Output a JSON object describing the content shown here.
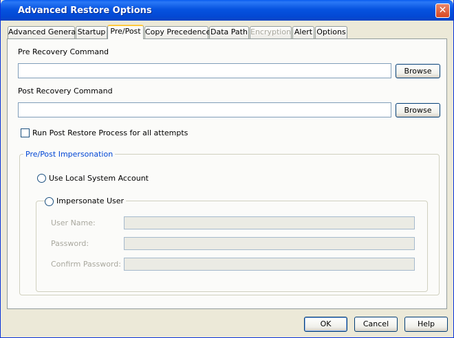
{
  "window": {
    "title": "Advanced Restore Options",
    "close_glyph": "✕"
  },
  "tabs": [
    {
      "label": "Advanced General",
      "state": "normal"
    },
    {
      "label": "Startup",
      "state": "normal"
    },
    {
      "label": "Pre/Post",
      "state": "active"
    },
    {
      "label": "Copy Precedence",
      "state": "normal"
    },
    {
      "label": "Data Path",
      "state": "normal"
    },
    {
      "label": "Encryption",
      "state": "disabled"
    },
    {
      "label": "Alert",
      "state": "normal"
    },
    {
      "label": "Options",
      "state": "normal"
    }
  ],
  "pre_recovery": {
    "label": "Pre Recovery Command",
    "value": "",
    "browse_label": "Browse"
  },
  "post_recovery": {
    "label": "Post Recovery Command",
    "value": "",
    "browse_label": "Browse"
  },
  "run_post_restore": {
    "label": "Run Post Restore Process for all attempts",
    "checked": false
  },
  "impersonation": {
    "legend": "Pre/Post Impersonation",
    "local_system_label": "Use Local System Account",
    "impersonate_label": "Impersonate User",
    "user_name_label": "User Name:",
    "password_label": "Password:",
    "confirm_password_label": "Confirm Password:"
  },
  "footer": {
    "ok_label": "OK",
    "cancel_label": "Cancel",
    "help_label": "Help"
  }
}
